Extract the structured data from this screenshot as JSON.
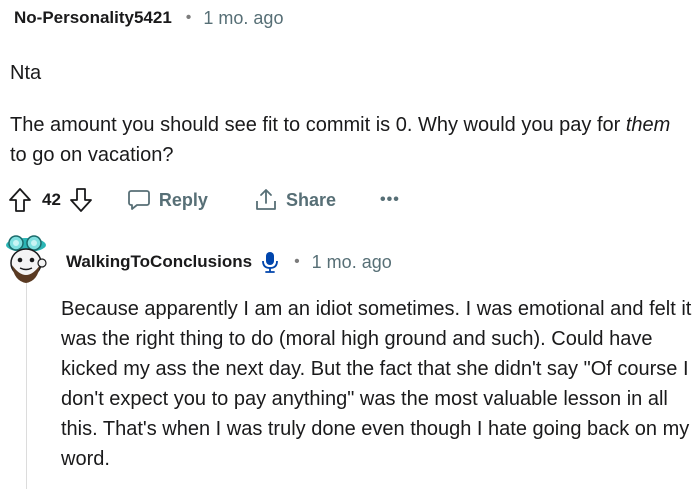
{
  "comment1": {
    "username": "No-Personality5421",
    "separator": "•",
    "time": "1 mo. ago",
    "paragraph1": "Nta",
    "paragraph2_part1": "The amount you should see fit to commit is 0. Why would you pay for ",
    "paragraph2_emphasis": "them",
    "paragraph2_part2": " to go on vacation?",
    "votes": "42",
    "reply_label": "Reply",
    "share_label": "Share",
    "more_label": "•••"
  },
  "comment2": {
    "username": "WalkingToConclusions",
    "separator": "•",
    "time": "1 mo. ago",
    "body": "Because apparently I am an idiot sometimes. I was emotional and felt it was the right thing to do (moral high ground and such). Could have kicked my ass the next day. But the fact that she didn't say \"Of course I don't expect you to pay anything\" was the most valuable lesson in all this. That's when I was truly done even though I hate going back on my word."
  },
  "icons": {
    "upvote": "upvote-arrow-icon",
    "downvote": "downvote-arrow-icon",
    "reply": "speech-bubble-icon",
    "share": "share-upload-icon",
    "mic": "microphone-icon",
    "avatar": "snoo-avatar"
  },
  "colors": {
    "text": "#1a1a1b",
    "meta": "#576f76",
    "thread_line": "#dcdcdc",
    "mic_blue": "#0045ac",
    "avatar_teal": "#35c6c6"
  }
}
